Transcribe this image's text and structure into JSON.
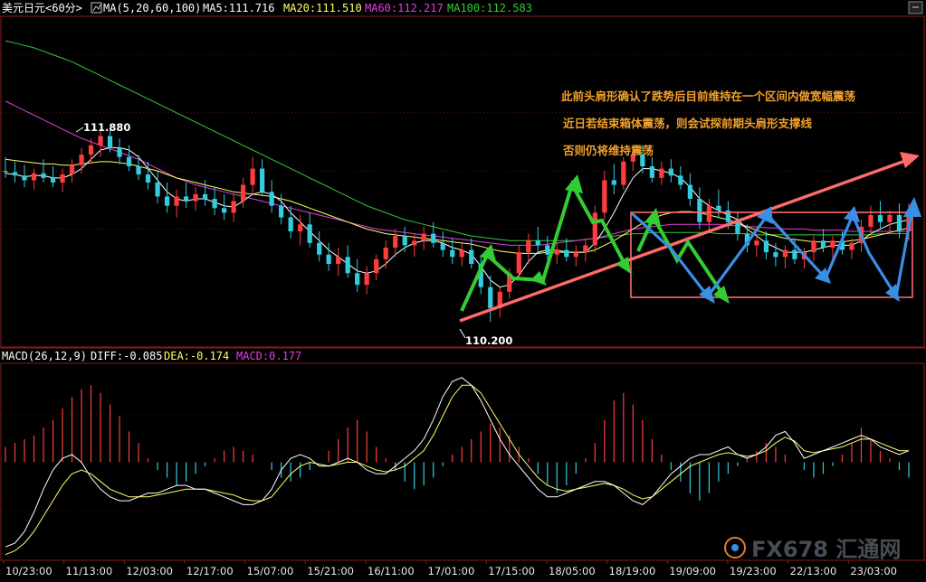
{
  "header": {
    "title": "美元日元<60分>",
    "ma_label": "MA(5,20,60,100)",
    "ma5": "MA5:111.716",
    "ma20": "MA20:111.510",
    "ma60": "MA60:112.217",
    "ma100": "MA100:112.583"
  },
  "macd_header": {
    "label": "MACD(26,12,9)",
    "diff": "DIFF:-0.085",
    "dea": "DEA:-0.174",
    "macd": "MACD:0.177"
  },
  "annotations": [
    "此前头肩形确认了跌势后目前维持在一个区间内做宽幅震荡",
    "近日若结束箱体震荡，则会试探前期头肩形支撑线",
    "否则仍将维持震荡"
  ],
  "watermark": "FX678 汇通网",
  "colors": {
    "up": "#ff3c3c",
    "down": "#33ccdd",
    "ma5": "#ffffff",
    "ma20": "#ffff66",
    "ma60": "#e040e0",
    "ma100": "#33cc33",
    "trend": "#ff6a6a",
    "zig_green": "#33cc33",
    "zig_blue": "#3a8ee6",
    "grid": "#8b1a1a"
  },
  "chart_data": {
    "type": "candlestick",
    "x_tick_labels": [
      "10/23:00",
      "11/13:00",
      "12/03:00",
      "12/17:00",
      "15/07:00",
      "15/21:00",
      "16/11:00",
      "17/01:00",
      "17/15:00",
      "18/05:00",
      "18/19:00",
      "19/09:00",
      "19/23:00",
      "22/13:00",
      "23/03:00"
    ],
    "price_range": [
      110.0,
      112.8
    ],
    "price_high_label": "111.880",
    "price_low_label": "110.200",
    "candles": [
      {
        "o": 111.5,
        "h": 111.62,
        "l": 111.44,
        "c": 111.49
      },
      {
        "o": 111.49,
        "h": 111.58,
        "l": 111.4,
        "c": 111.46
      },
      {
        "o": 111.46,
        "h": 111.55,
        "l": 111.36,
        "c": 111.42
      },
      {
        "o": 111.42,
        "h": 111.52,
        "l": 111.34,
        "c": 111.48
      },
      {
        "o": 111.48,
        "h": 111.6,
        "l": 111.4,
        "c": 111.44
      },
      {
        "o": 111.44,
        "h": 111.54,
        "l": 111.36,
        "c": 111.4
      },
      {
        "o": 111.4,
        "h": 111.52,
        "l": 111.32,
        "c": 111.47
      },
      {
        "o": 111.47,
        "h": 111.6,
        "l": 111.4,
        "c": 111.55
      },
      {
        "o": 111.55,
        "h": 111.7,
        "l": 111.48,
        "c": 111.64
      },
      {
        "o": 111.64,
        "h": 111.78,
        "l": 111.56,
        "c": 111.72
      },
      {
        "o": 111.72,
        "h": 111.86,
        "l": 111.62,
        "c": 111.8
      },
      {
        "o": 111.8,
        "h": 111.88,
        "l": 111.66,
        "c": 111.7
      },
      {
        "o": 111.7,
        "h": 111.78,
        "l": 111.56,
        "c": 111.62
      },
      {
        "o": 111.62,
        "h": 111.72,
        "l": 111.5,
        "c": 111.54
      },
      {
        "o": 111.54,
        "h": 111.64,
        "l": 111.42,
        "c": 111.47
      },
      {
        "o": 111.47,
        "h": 111.58,
        "l": 111.34,
        "c": 111.4
      },
      {
        "o": 111.4,
        "h": 111.5,
        "l": 111.22,
        "c": 111.28
      },
      {
        "o": 111.28,
        "h": 111.4,
        "l": 111.14,
        "c": 111.2
      },
      {
        "o": 111.2,
        "h": 111.34,
        "l": 111.1,
        "c": 111.28
      },
      {
        "o": 111.28,
        "h": 111.4,
        "l": 111.18,
        "c": 111.24
      },
      {
        "o": 111.24,
        "h": 111.36,
        "l": 111.16,
        "c": 111.3
      },
      {
        "o": 111.3,
        "h": 111.42,
        "l": 111.2,
        "c": 111.26
      },
      {
        "o": 111.26,
        "h": 111.36,
        "l": 111.12,
        "c": 111.18
      },
      {
        "o": 111.18,
        "h": 111.3,
        "l": 111.08,
        "c": 111.14
      },
      {
        "o": 111.14,
        "h": 111.3,
        "l": 111.06,
        "c": 111.24
      },
      {
        "o": 111.24,
        "h": 111.44,
        "l": 111.18,
        "c": 111.38
      },
      {
        "o": 111.38,
        "h": 111.62,
        "l": 111.3,
        "c": 111.52
      },
      {
        "o": 111.52,
        "h": 111.6,
        "l": 111.28,
        "c": 111.32
      },
      {
        "o": 111.32,
        "h": 111.42,
        "l": 111.14,
        "c": 111.2
      },
      {
        "o": 111.2,
        "h": 111.3,
        "l": 111.04,
        "c": 111.1
      },
      {
        "o": 111.1,
        "h": 111.2,
        "l": 110.92,
        "c": 110.98
      },
      {
        "o": 110.98,
        "h": 111.12,
        "l": 110.86,
        "c": 111.04
      },
      {
        "o": 111.04,
        "h": 111.14,
        "l": 110.84,
        "c": 110.88
      },
      {
        "o": 110.88,
        "h": 110.98,
        "l": 110.72,
        "c": 110.78
      },
      {
        "o": 110.78,
        "h": 110.88,
        "l": 110.64,
        "c": 110.7
      },
      {
        "o": 110.7,
        "h": 110.84,
        "l": 110.6,
        "c": 110.76
      },
      {
        "o": 110.76,
        "h": 110.86,
        "l": 110.58,
        "c": 110.62
      },
      {
        "o": 110.62,
        "h": 110.74,
        "l": 110.46,
        "c": 110.52
      },
      {
        "o": 110.52,
        "h": 110.68,
        "l": 110.44,
        "c": 110.62
      },
      {
        "o": 110.62,
        "h": 110.78,
        "l": 110.56,
        "c": 110.74
      },
      {
        "o": 110.74,
        "h": 110.9,
        "l": 110.66,
        "c": 110.84
      },
      {
        "o": 110.84,
        "h": 111.0,
        "l": 110.76,
        "c": 110.94
      },
      {
        "o": 110.94,
        "h": 111.02,
        "l": 110.8,
        "c": 110.86
      },
      {
        "o": 110.86,
        "h": 110.96,
        "l": 110.76,
        "c": 110.9
      },
      {
        "o": 110.9,
        "h": 111.02,
        "l": 110.82,
        "c": 110.96
      },
      {
        "o": 110.96,
        "h": 111.06,
        "l": 110.84,
        "c": 110.88
      },
      {
        "o": 110.88,
        "h": 110.98,
        "l": 110.76,
        "c": 110.82
      },
      {
        "o": 110.82,
        "h": 110.92,
        "l": 110.7,
        "c": 110.76
      },
      {
        "o": 110.76,
        "h": 110.88,
        "l": 110.68,
        "c": 110.82
      },
      {
        "o": 110.82,
        "h": 110.92,
        "l": 110.66,
        "c": 110.7
      },
      {
        "o": 110.7,
        "h": 110.78,
        "l": 110.44,
        "c": 110.5
      },
      {
        "o": 110.5,
        "h": 110.6,
        "l": 110.2,
        "c": 110.32
      },
      {
        "o": 110.32,
        "h": 110.5,
        "l": 110.24,
        "c": 110.46
      },
      {
        "o": 110.46,
        "h": 110.66,
        "l": 110.4,
        "c": 110.62
      },
      {
        "o": 110.62,
        "h": 110.86,
        "l": 110.56,
        "c": 110.8
      },
      {
        "o": 110.8,
        "h": 110.96,
        "l": 110.7,
        "c": 110.9
      },
      {
        "o": 110.9,
        "h": 111.02,
        "l": 110.8,
        "c": 110.86
      },
      {
        "o": 110.86,
        "h": 110.94,
        "l": 110.74,
        "c": 110.78
      },
      {
        "o": 110.78,
        "h": 110.88,
        "l": 110.7,
        "c": 110.82
      },
      {
        "o": 110.82,
        "h": 110.92,
        "l": 110.72,
        "c": 110.76
      },
      {
        "o": 110.76,
        "h": 110.86,
        "l": 110.68,
        "c": 110.8
      },
      {
        "o": 110.8,
        "h": 110.92,
        "l": 110.72,
        "c": 110.86
      },
      {
        "o": 110.86,
        "h": 111.2,
        "l": 110.8,
        "c": 111.14
      },
      {
        "o": 111.14,
        "h": 111.5,
        "l": 111.08,
        "c": 111.42
      },
      {
        "o": 111.42,
        "h": 111.56,
        "l": 111.3,
        "c": 111.38
      },
      {
        "o": 111.38,
        "h": 111.62,
        "l": 111.34,
        "c": 111.58
      },
      {
        "o": 111.58,
        "h": 111.7,
        "l": 111.5,
        "c": 111.64
      },
      {
        "o": 111.64,
        "h": 111.72,
        "l": 111.48,
        "c": 111.54
      },
      {
        "o": 111.54,
        "h": 111.62,
        "l": 111.4,
        "c": 111.44
      },
      {
        "o": 111.44,
        "h": 111.58,
        "l": 111.38,
        "c": 111.52
      },
      {
        "o": 111.52,
        "h": 111.6,
        "l": 111.4,
        "c": 111.46
      },
      {
        "o": 111.46,
        "h": 111.54,
        "l": 111.34,
        "c": 111.38
      },
      {
        "o": 111.38,
        "h": 111.48,
        "l": 111.2,
        "c": 111.26
      },
      {
        "o": 111.26,
        "h": 111.36,
        "l": 111.0,
        "c": 111.06
      },
      {
        "o": 111.06,
        "h": 111.26,
        "l": 110.98,
        "c": 111.2
      },
      {
        "o": 111.2,
        "h": 111.34,
        "l": 111.1,
        "c": 111.16
      },
      {
        "o": 111.16,
        "h": 111.24,
        "l": 111.0,
        "c": 111.06
      },
      {
        "o": 111.06,
        "h": 111.14,
        "l": 110.9,
        "c": 110.96
      },
      {
        "o": 110.96,
        "h": 111.04,
        "l": 110.8,
        "c": 110.86
      },
      {
        "o": 110.86,
        "h": 110.96,
        "l": 110.76,
        "c": 110.9
      },
      {
        "o": 110.9,
        "h": 110.98,
        "l": 110.74,
        "c": 110.8
      },
      {
        "o": 110.8,
        "h": 110.88,
        "l": 110.68,
        "c": 110.76
      },
      {
        "o": 110.76,
        "h": 110.86,
        "l": 110.66,
        "c": 110.82
      },
      {
        "o": 110.82,
        "h": 110.92,
        "l": 110.7,
        "c": 110.74
      },
      {
        "o": 110.74,
        "h": 110.84,
        "l": 110.66,
        "c": 110.8
      },
      {
        "o": 110.8,
        "h": 110.94,
        "l": 110.72,
        "c": 110.9
      },
      {
        "o": 110.9,
        "h": 111.0,
        "l": 110.8,
        "c": 110.84
      },
      {
        "o": 110.84,
        "h": 110.94,
        "l": 110.74,
        "c": 110.9
      },
      {
        "o": 110.9,
        "h": 110.98,
        "l": 110.78,
        "c": 110.82
      },
      {
        "o": 110.82,
        "h": 110.92,
        "l": 110.74,
        "c": 110.88
      },
      {
        "o": 110.88,
        "h": 111.08,
        "l": 110.8,
        "c": 111.02
      },
      {
        "o": 111.02,
        "h": 111.2,
        "l": 110.94,
        "c": 111.12
      },
      {
        "o": 111.12,
        "h": 111.24,
        "l": 111.0,
        "c": 111.06
      },
      {
        "o": 111.06,
        "h": 111.16,
        "l": 110.96,
        "c": 111.12
      },
      {
        "o": 111.12,
        "h": 111.22,
        "l": 110.92,
        "c": 110.98
      },
      {
        "o": 110.98,
        "h": 111.22,
        "l": 110.9,
        "c": 111.16
      }
    ],
    "ma5": [
      111.48,
      111.47,
      111.45,
      111.46,
      111.46,
      111.44,
      111.44,
      111.47,
      111.52,
      111.6,
      111.68,
      111.7,
      111.7,
      111.68,
      111.62,
      111.52,
      111.42,
      111.32,
      111.26,
      111.24,
      111.26,
      111.26,
      111.23,
      111.2,
      111.19,
      111.24,
      111.3,
      111.32,
      111.3,
      111.24,
      111.14,
      111.06,
      110.98,
      110.9,
      110.82,
      110.76,
      110.7,
      110.64,
      110.62,
      110.64,
      110.7,
      110.78,
      110.84,
      110.88,
      110.9,
      110.9,
      110.88,
      110.84,
      110.82,
      110.78,
      110.68,
      110.56,
      110.5,
      110.52,
      110.6,
      110.72,
      110.8,
      110.82,
      110.82,
      110.8,
      110.8,
      110.8,
      110.88,
      111.0,
      111.14,
      111.3,
      111.44,
      111.52,
      111.52,
      111.5,
      111.48,
      111.44,
      111.36,
      111.26,
      111.2,
      111.16,
      111.12,
      111.08,
      111.0,
      110.94,
      110.88,
      110.84,
      110.8,
      110.8,
      110.8,
      110.82,
      110.84,
      110.86,
      110.86,
      110.86,
      110.9,
      110.96,
      111.0,
      111.04,
      111.06,
      111.08
    ],
    "ma20": [
      111.6,
      111.59,
      111.58,
      111.57,
      111.56,
      111.56,
      111.55,
      111.55,
      111.56,
      111.57,
      111.58,
      111.58,
      111.57,
      111.56,
      111.54,
      111.52,
      111.5,
      111.47,
      111.44,
      111.42,
      111.4,
      111.38,
      111.36,
      111.34,
      111.32,
      111.31,
      111.3,
      111.29,
      111.28,
      111.26,
      111.24,
      111.21,
      111.18,
      111.15,
      111.12,
      111.09,
      111.06,
      111.03,
      111.0,
      110.98,
      110.96,
      110.95,
      110.94,
      110.93,
      110.92,
      110.91,
      110.9,
      110.89,
      110.88,
      110.87,
      110.85,
      110.83,
      110.81,
      110.8,
      110.79,
      110.79,
      110.79,
      110.8,
      110.8,
      110.8,
      110.8,
      110.8,
      110.82,
      110.86,
      110.9,
      110.95,
      111.0,
      111.05,
      111.09,
      111.12,
      111.14,
      111.15,
      111.15,
      111.14,
      111.12,
      111.1,
      111.08,
      111.05,
      111.02,
      110.99,
      110.96,
      110.94,
      110.92,
      110.91,
      110.9,
      110.89,
      110.89,
      110.89,
      110.89,
      110.9,
      110.91,
      110.93,
      110.95,
      110.97,
      110.99,
      111.01
    ],
    "ma60": [
      112.1,
      112.06,
      112.02,
      111.98,
      111.94,
      111.9,
      111.86,
      111.82,
      111.78,
      111.75,
      111.72,
      111.69,
      111.66,
      111.63,
      111.6,
      111.56,
      111.52,
      111.48,
      111.44,
      111.41,
      111.38,
      111.36,
      111.34,
      111.32,
      111.3,
      111.28,
      111.26,
      111.24,
      111.22,
      111.2,
      111.18,
      111.16,
      111.14,
      111.12,
      111.1,
      111.08,
      111.06,
      111.04,
      111.02,
      111.0,
      110.99,
      110.98,
      110.97,
      110.96,
      110.95,
      110.94,
      110.93,
      110.92,
      110.91,
      110.9,
      110.89,
      110.88,
      110.87,
      110.86,
      110.86,
      110.86,
      110.86,
      110.87,
      110.88,
      110.89,
      110.9,
      110.91,
      110.92,
      110.94,
      110.96,
      110.98,
      111.0,
      111.01,
      111.02,
      111.03,
      111.04,
      111.04,
      111.04,
      111.04,
      111.04,
      111.04,
      111.03,
      111.03,
      111.02,
      111.02,
      111.01,
      111.01,
      111.0,
      111.0,
      111.0,
      110.99,
      110.99,
      110.99,
      110.99,
      110.98,
      110.98,
      110.98,
      110.98,
      110.98,
      110.98,
      110.98
    ],
    "ma100": [
      112.62,
      112.6,
      112.58,
      112.56,
      112.53,
      112.5,
      112.47,
      112.44,
      112.4,
      112.36,
      112.32,
      112.28,
      112.24,
      112.2,
      112.16,
      112.12,
      112.08,
      112.04,
      112.0,
      111.96,
      111.92,
      111.88,
      111.84,
      111.8,
      111.76,
      111.72,
      111.68,
      111.64,
      111.6,
      111.56,
      111.52,
      111.48,
      111.44,
      111.4,
      111.36,
      111.32,
      111.28,
      111.24,
      111.2,
      111.17,
      111.14,
      111.11,
      111.08,
      111.06,
      111.04,
      111.02,
      111.0,
      110.98,
      110.96,
      110.94,
      110.93,
      110.92,
      110.91,
      110.9,
      110.9,
      110.9,
      110.9,
      110.9,
      110.9,
      110.9,
      110.9,
      110.91,
      110.92,
      110.93,
      110.94,
      110.95,
      110.96,
      110.96,
      110.97,
      110.97,
      110.97,
      110.97,
      110.97,
      110.97,
      110.97,
      110.96,
      110.96,
      110.96,
      110.96,
      110.95,
      110.95,
      110.95,
      110.95,
      110.95,
      110.95,
      110.95,
      110.95,
      110.95,
      110.95,
      110.95,
      110.95,
      110.95,
      110.96,
      110.96,
      110.96,
      110.96
    ],
    "macd_range": [
      -0.5,
      0.5
    ],
    "macd_hist": [
      0.08,
      0.1,
      0.12,
      0.14,
      0.18,
      0.22,
      0.28,
      0.34,
      0.38,
      0.4,
      0.36,
      0.3,
      0.24,
      0.16,
      0.1,
      0.02,
      -0.04,
      -0.08,
      -0.12,
      -0.1,
      -0.06,
      -0.02,
      0.02,
      0.06,
      0.08,
      0.06,
      0.04,
      0.0,
      -0.04,
      -0.08,
      -0.1,
      -0.08,
      -0.04,
      0.0,
      0.06,
      0.12,
      0.18,
      0.22,
      0.16,
      0.08,
      0.02,
      -0.04,
      -0.1,
      -0.14,
      -0.12,
      -0.08,
      -0.02,
      0.04,
      0.08,
      0.12,
      0.16,
      0.2,
      0.18,
      0.14,
      0.08,
      0.02,
      -0.06,
      -0.12,
      -0.16,
      -0.12,
      -0.06,
      0.02,
      0.1,
      0.22,
      0.32,
      0.36,
      0.3,
      0.22,
      0.12,
      0.04,
      -0.04,
      -0.1,
      -0.16,
      -0.2,
      -0.16,
      -0.1,
      -0.06,
      -0.02,
      0.02,
      0.06,
      0.1,
      0.08,
      0.04,
      0.0,
      -0.04,
      -0.08,
      -0.06,
      -0.02,
      0.04,
      0.1,
      0.18,
      0.12,
      0.06,
      0.02,
      -0.04,
      -0.08
    ],
    "diff": [
      -0.44,
      -0.42,
      -0.36,
      -0.26,
      -0.14,
      -0.04,
      0.02,
      0.04,
      0.0,
      -0.08,
      -0.14,
      -0.18,
      -0.2,
      -0.2,
      -0.18,
      -0.16,
      -0.16,
      -0.14,
      -0.12,
      -0.12,
      -0.14,
      -0.14,
      -0.16,
      -0.18,
      -0.2,
      -0.22,
      -0.22,
      -0.2,
      -0.14,
      -0.04,
      0.02,
      0.04,
      0.02,
      -0.02,
      -0.02,
      0.0,
      0.02,
      0.0,
      -0.04,
      -0.06,
      -0.06,
      -0.02,
      0.02,
      0.06,
      0.12,
      0.22,
      0.34,
      0.42,
      0.44,
      0.4,
      0.32,
      0.22,
      0.12,
      0.04,
      -0.02,
      -0.08,
      -0.14,
      -0.18,
      -0.18,
      -0.16,
      -0.14,
      -0.12,
      -0.1,
      -0.1,
      -0.12,
      -0.16,
      -0.2,
      -0.22,
      -0.18,
      -0.12,
      -0.06,
      -0.02,
      0.02,
      0.04,
      0.04,
      0.06,
      0.08,
      0.04,
      0.02,
      0.04,
      0.08,
      0.14,
      0.16,
      0.1,
      0.02,
      0.04,
      0.06,
      0.08,
      0.1,
      0.12,
      0.14,
      0.12,
      0.08,
      0.06,
      0.04,
      0.06
    ],
    "dea": [
      -0.48,
      -0.46,
      -0.42,
      -0.36,
      -0.28,
      -0.2,
      -0.12,
      -0.06,
      -0.04,
      -0.06,
      -0.1,
      -0.14,
      -0.16,
      -0.18,
      -0.18,
      -0.18,
      -0.17,
      -0.16,
      -0.15,
      -0.14,
      -0.14,
      -0.14,
      -0.15,
      -0.16,
      -0.17,
      -0.19,
      -0.2,
      -0.2,
      -0.18,
      -0.12,
      -0.06,
      -0.02,
      0.0,
      -0.01,
      -0.02,
      -0.01,
      0.0,
      0.0,
      -0.02,
      -0.04,
      -0.05,
      -0.04,
      -0.02,
      0.02,
      0.06,
      0.14,
      0.24,
      0.34,
      0.4,
      0.4,
      0.36,
      0.28,
      0.2,
      0.12,
      0.04,
      -0.02,
      -0.08,
      -0.12,
      -0.14,
      -0.15,
      -0.14,
      -0.13,
      -0.12,
      -0.11,
      -0.12,
      -0.14,
      -0.17,
      -0.19,
      -0.18,
      -0.14,
      -0.1,
      -0.06,
      -0.02,
      0.0,
      0.02,
      0.04,
      0.05,
      0.04,
      0.03,
      0.04,
      0.06,
      0.1,
      0.13,
      0.11,
      0.06,
      0.05,
      0.06,
      0.07,
      0.08,
      0.1,
      0.12,
      0.12,
      0.1,
      0.08,
      0.06,
      0.06
    ]
  }
}
